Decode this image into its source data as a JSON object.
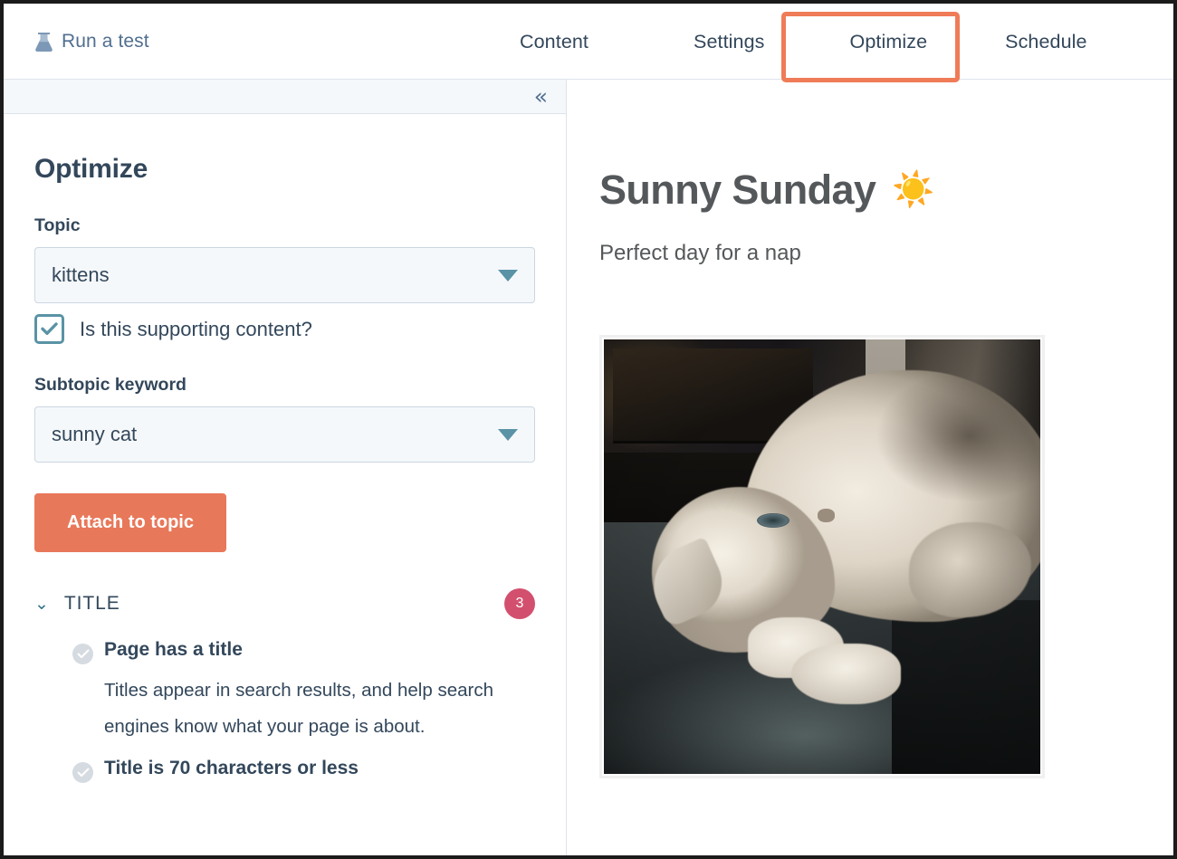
{
  "topnav": {
    "run_test_label": "Run a test",
    "run_test_icon": "flask-icon",
    "tabs": [
      {
        "label": "Content",
        "active": false
      },
      {
        "label": "Settings",
        "active": false
      },
      {
        "label": "Optimize",
        "active": true
      },
      {
        "label": "Schedule",
        "active": false
      }
    ],
    "highlight_color": "#ef7b57"
  },
  "left_panel": {
    "collapse_icon": "chevron-double-left-icon",
    "collapse_glyph": "«",
    "title": "Optimize",
    "topic": {
      "label": "Topic",
      "value": "kittens",
      "caret_icon": "chevron-down-icon"
    },
    "supporting_content": {
      "label": "Is this supporting content?",
      "checked": true,
      "accent": "#5a93a5"
    },
    "subtopic": {
      "label": "Subtopic keyword",
      "value": "sunny cat",
      "caret_icon": "chevron-down-icon"
    },
    "attach_button": {
      "label": "Attach to topic",
      "color": "#e8785a"
    },
    "section": {
      "expand_glyph": "⌄",
      "title": "TITLE",
      "badge_count": "3",
      "badge_color": "#d2506e"
    },
    "checks": [
      {
        "title": "Page has a title",
        "desc": "Titles appear in search results, and help search engines know what your page is about.",
        "state": "complete"
      },
      {
        "title": "Title is 70 characters or less",
        "desc": "",
        "state": "complete"
      }
    ]
  },
  "preview": {
    "title": "Sunny Sunday",
    "title_emoji": "☀️",
    "subtitle": "Perfect day for a nap",
    "image_alt": "Fluffy white and gray cat lying on its side on a dark couch"
  }
}
